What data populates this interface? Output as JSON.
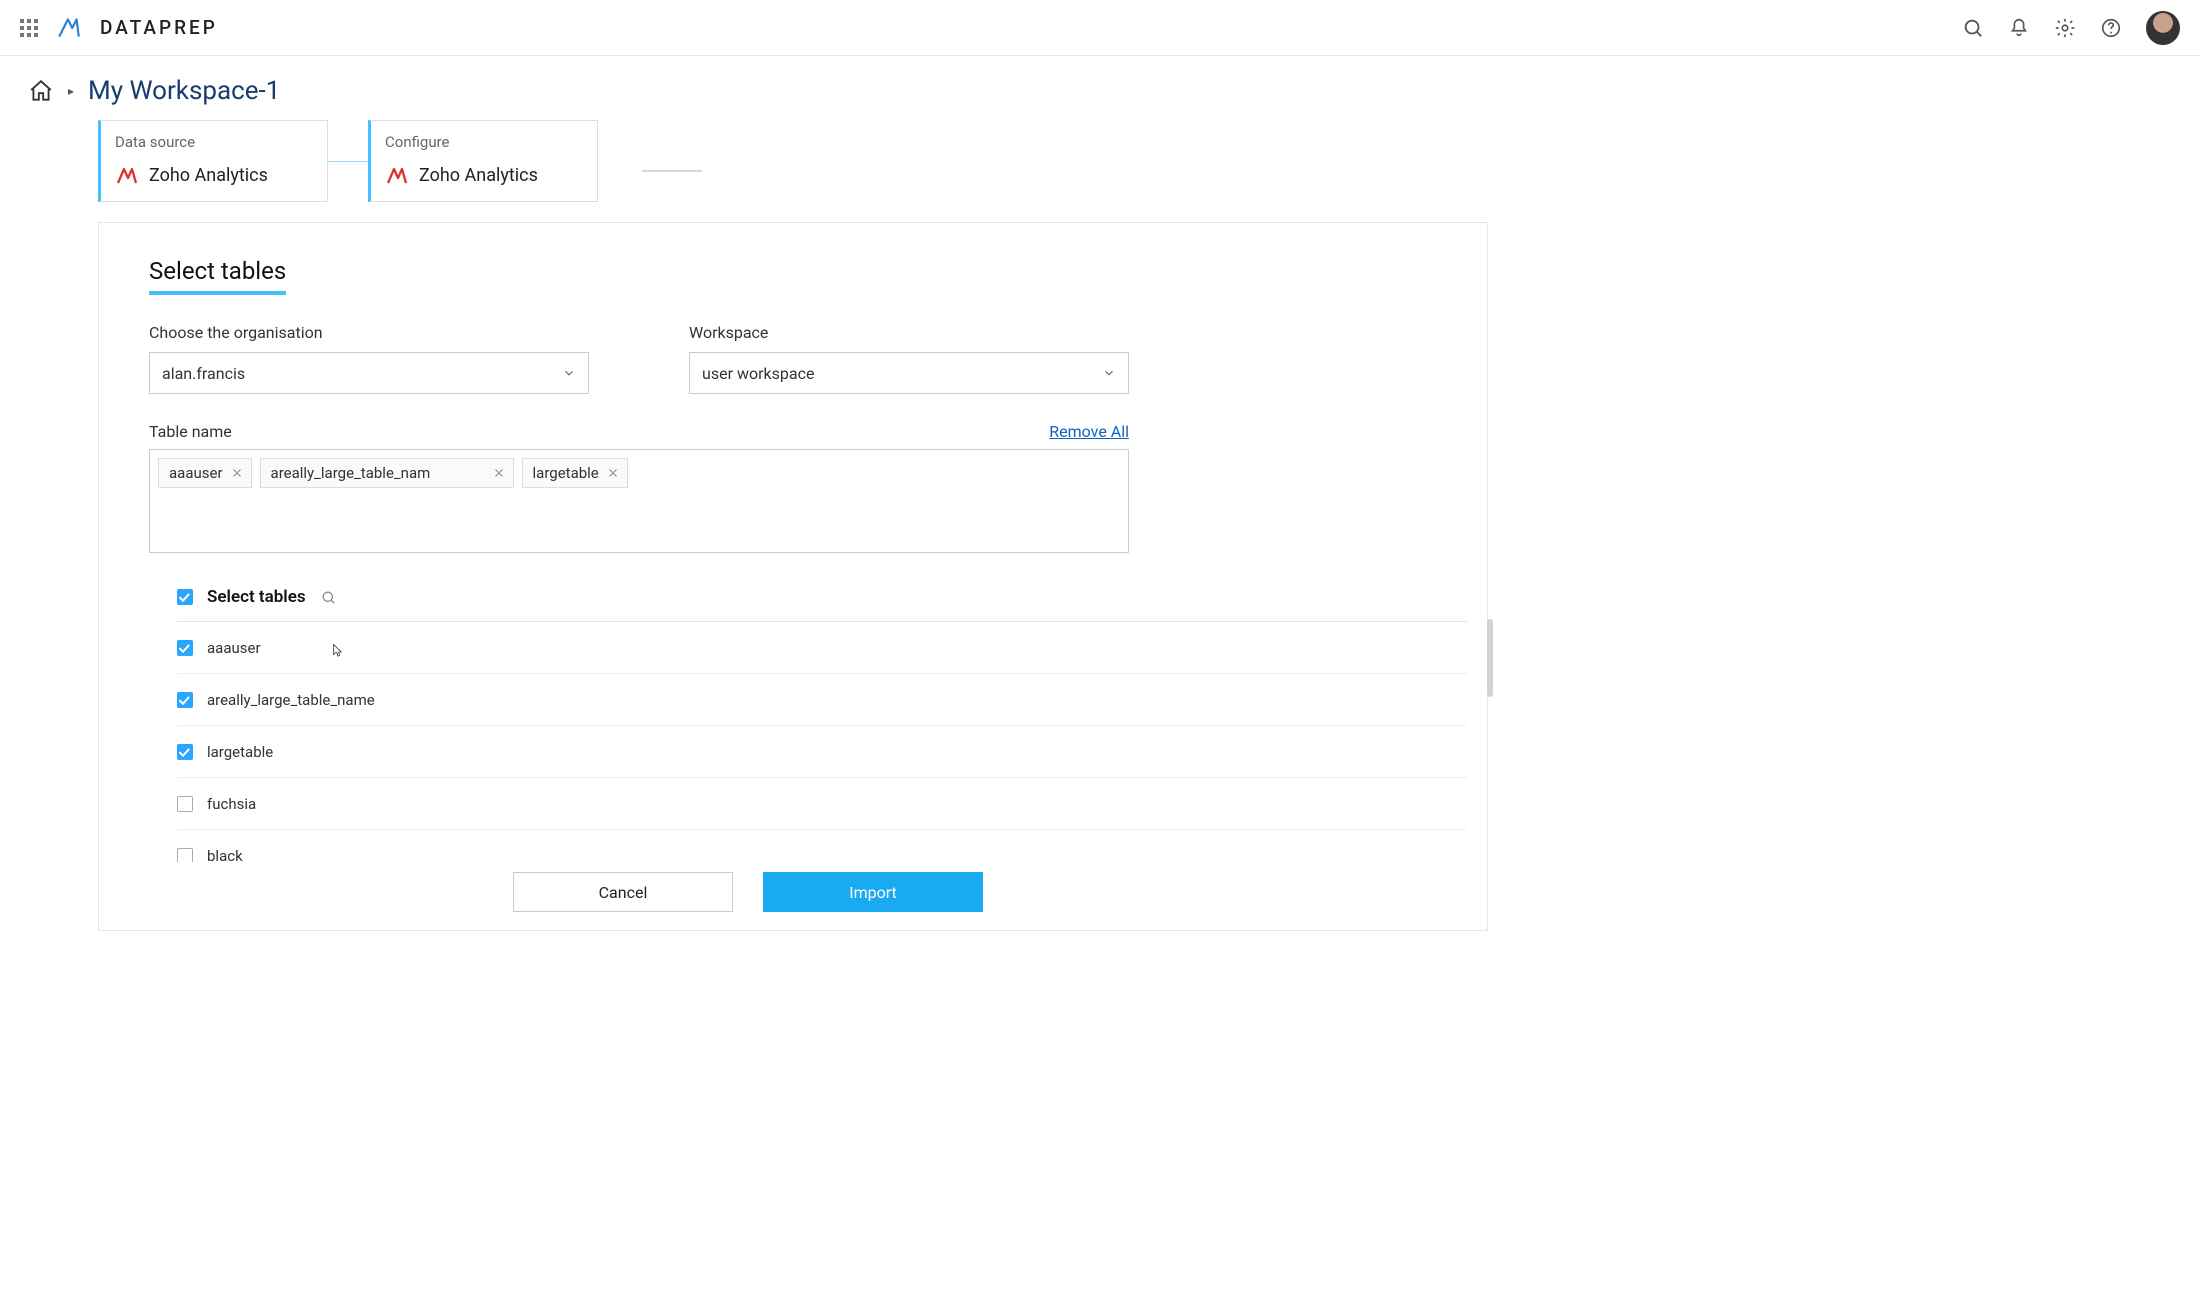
{
  "header": {
    "app_name": "DATAPREP"
  },
  "breadcrumb": {
    "title": "My Workspace-1"
  },
  "steps": [
    {
      "label": "Data source",
      "name": "Zoho Analytics"
    },
    {
      "label": "Configure",
      "name": "Zoho Analytics"
    }
  ],
  "panel": {
    "title": "Select tables",
    "org_label": "Choose the organisation",
    "org_value": "alan.francis",
    "ws_label": "Workspace",
    "ws_value": "user workspace",
    "tablename_label": "Table name",
    "remove_all": "Remove All",
    "tags": [
      "aaauser",
      "areally_large_table_nam",
      "largetable"
    ],
    "list_label": "Select tables",
    "tables": [
      {
        "name": "aaauser",
        "checked": true
      },
      {
        "name": "areally_large_table_name",
        "checked": true
      },
      {
        "name": "largetable",
        "checked": true
      },
      {
        "name": "fuchsia",
        "checked": false
      },
      {
        "name": "black",
        "checked": false
      }
    ],
    "cancel": "Cancel",
    "import": "Import"
  }
}
